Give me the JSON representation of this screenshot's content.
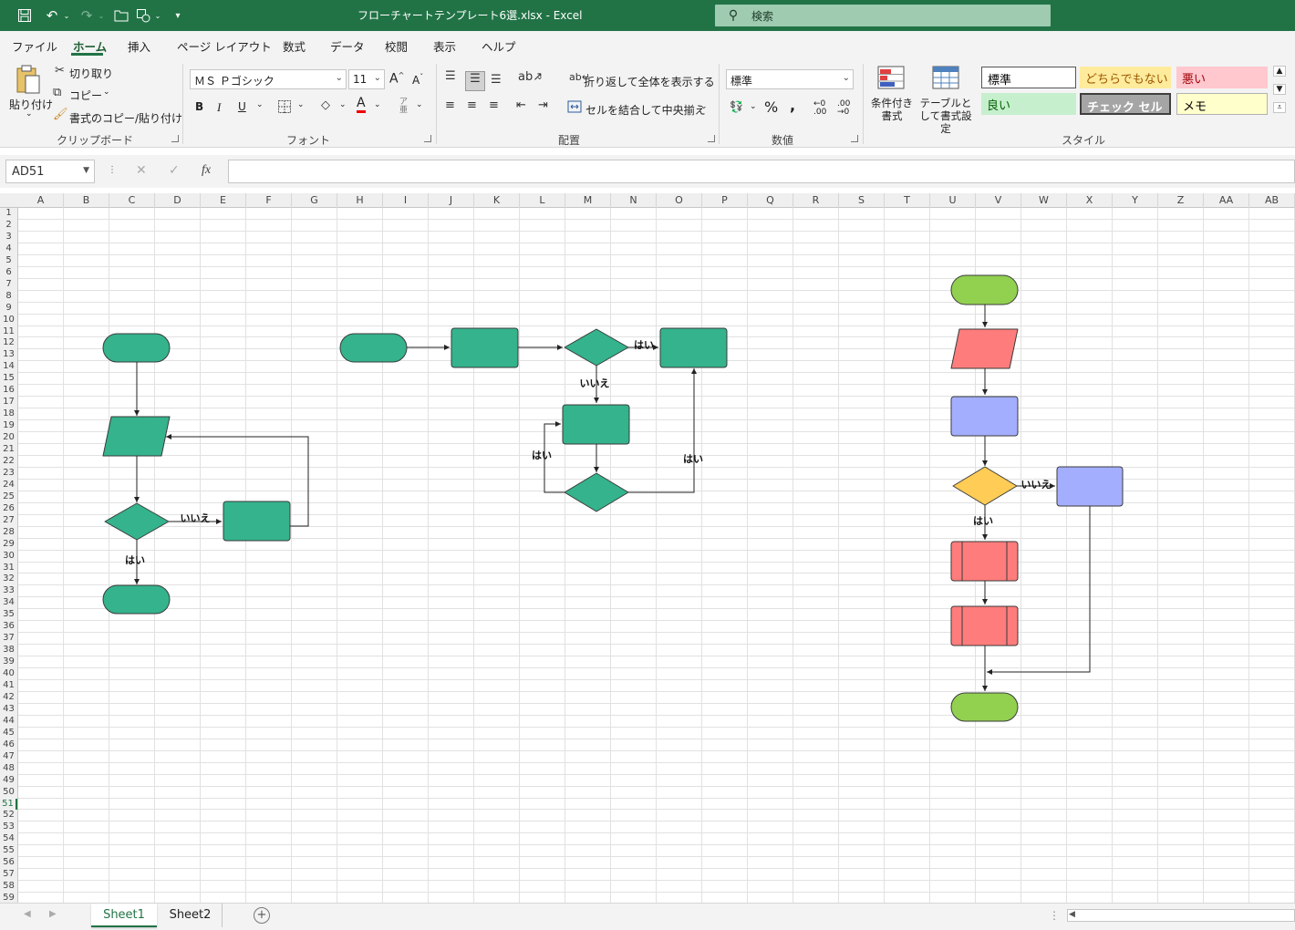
{
  "titlebar": {
    "title": "フローチャートテンプレート6選.xlsx  -  Excel",
    "search_placeholder": "検索"
  },
  "menu": {
    "tabs": [
      "ファイル",
      "ホーム",
      "挿入",
      "ページ レイアウト",
      "数式",
      "データ",
      "校閲",
      "表示",
      "ヘルプ"
    ],
    "active": "ホーム"
  },
  "ribbon": {
    "clipboard": {
      "paste": "貼り付け",
      "cut": "切り取り",
      "copy": "コピー",
      "format_painter": "書式のコピー/貼り付け",
      "label": "クリップボード"
    },
    "font": {
      "name": "ＭＳ Ｐゴシック",
      "size": "11",
      "label": "フォント",
      "bold": "B",
      "italic": "I",
      "underline": "U"
    },
    "alignment": {
      "wrap": "折り返して全体を表示する",
      "merge": "セルを結合して中央揃え",
      "label": "配置"
    },
    "number": {
      "format": "標準",
      "label": "数値"
    },
    "styles": {
      "conditional": "条件付き書式",
      "table": "テーブルとして書式設定",
      "label": "スタイル",
      "cells": [
        {
          "text": "標準",
          "bg": "#ffffff",
          "fg": "#000000"
        },
        {
          "text": "どちらでもない",
          "bg": "#ffeb9c",
          "fg": "#9c5700"
        },
        {
          "text": "悪い",
          "bg": "#ffc7ce",
          "fg": "#9c0006"
        },
        {
          "text": "良い",
          "bg": "#c6efce",
          "fg": "#006100"
        },
        {
          "text": "チェック セル",
          "bg": "#a5a5a5",
          "fg": "#ffffff"
        },
        {
          "text": "メモ",
          "bg": "#ffffcc",
          "fg": "#000000"
        }
      ]
    }
  },
  "formula": {
    "namebox": "AD51",
    "fx": "fx",
    "value": ""
  },
  "grid": {
    "columns": [
      "A",
      "B",
      "C",
      "D",
      "E",
      "F",
      "G",
      "H",
      "I",
      "J",
      "K",
      "L",
      "M",
      "N",
      "O",
      "P",
      "Q",
      "R",
      "S",
      "T",
      "U",
      "V",
      "W",
      "X",
      "Y",
      "Z",
      "AA",
      "AB"
    ],
    "row_count": 59,
    "selected_row": 51
  },
  "flowcharts": {
    "yes": "はい",
    "no": "いいえ",
    "colors": {
      "teal": "#34b38c",
      "green": "#92d050",
      "red": "#ff7c7c",
      "blue": "#a4aeff",
      "yellow": "#ffcc55",
      "stroke": "#3a3a3a"
    }
  },
  "sheets": {
    "tabs": [
      "Sheet1",
      "Sheet2"
    ],
    "active": "Sheet1"
  }
}
